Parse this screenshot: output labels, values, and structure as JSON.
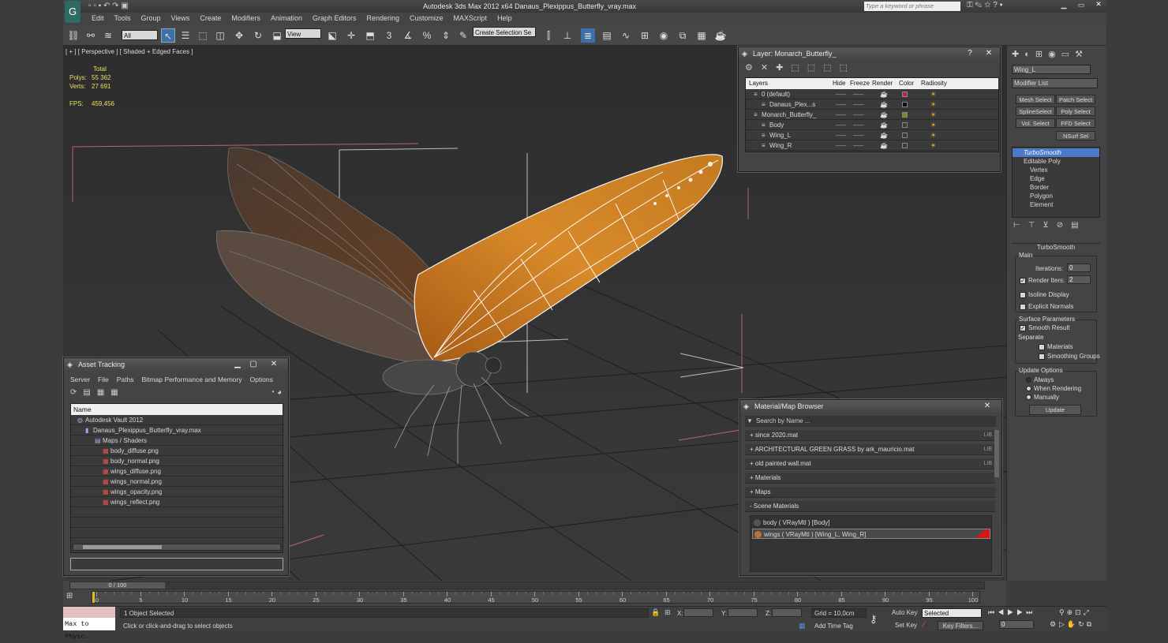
{
  "window": {
    "title": "Autodesk 3ds Max  2012 x64     Danaus_Plexippus_Butterfly_vray.max",
    "search_placeholder": "Type a keyword or phrase"
  },
  "menu": [
    "Edit",
    "Tools",
    "Group",
    "Views",
    "Create",
    "Modifiers",
    "Animation",
    "Graph Editors",
    "Rendering",
    "Customize",
    "MAXScript",
    "Help"
  ],
  "toolbar": {
    "filter": "All",
    "refcoord": "View",
    "selection_set": "Create Selection Se"
  },
  "viewport": {
    "label": "[ + ] [ Perspective ] [ Shaded + Edged Faces ]",
    "stats": {
      "header": "Total",
      "polys_label": "Polys:",
      "polys": "55 362",
      "verts_label": "Verts:",
      "verts": "27 691",
      "fps_label": "FPS:",
      "fps": "459,456"
    }
  },
  "layer_panel": {
    "title": "Layer: Monarch_Butterfly_",
    "columns": [
      "Layers",
      "Hide",
      "Freeze",
      "Render",
      "Color",
      "Radiosity"
    ],
    "rows": [
      {
        "name": "0 (default)",
        "color": "#c0205a"
      },
      {
        "name": "Danaus_Plex...s",
        "color": "#111111"
      },
      {
        "name": "Monarch_Butterfly_",
        "color": "#7a8a20"
      },
      {
        "name": "Body",
        "color": "#3a3a3a"
      },
      {
        "name": "Wing_L",
        "color": "#3a3a3a"
      },
      {
        "name": "Wing_R",
        "color": "#3a3a3a"
      }
    ]
  },
  "asset_panel": {
    "title": "Asset Tracking",
    "menu": [
      "Server",
      "File",
      "Paths",
      "Bitmap Performance and Memory",
      "Options"
    ],
    "column": "Name",
    "items": [
      "Autodesk Vault 2012",
      "Danaus_Plexippus_Butterfly_vray.max",
      "Maps / Shaders",
      "body_diffuse.png",
      "body_normal.png",
      "wings_diffuse.png",
      "wings_normal.png",
      "wings_opacity.png",
      "wings_reflect.png"
    ]
  },
  "material_panel": {
    "title": "Material/Map Browser",
    "search": "Search by Name ...",
    "libs": [
      {
        "name": "+ since 2020.mat",
        "tag": "LIB"
      },
      {
        "name": "+ ARCHITECTURAL GREEN GRASS by ark_mauricio.mat",
        "tag": "LIB"
      },
      {
        "name": "+ old painted wall.mat",
        "tag": "LIB"
      },
      {
        "name": "+ Materials",
        "tag": ""
      },
      {
        "name": "+ Maps",
        "tag": ""
      },
      {
        "name": "- Scene Materials",
        "tag": ""
      }
    ],
    "scene": [
      "body  ( VRayMtl )  [Body]",
      "wings  ( VRayMtl )  [Wing_L, Wing_R]"
    ]
  },
  "command_panel": {
    "object_name": "Wing_L",
    "modifier_list": "Modifier List",
    "buttons": [
      "Mesh Select",
      "Patch Select",
      "SplineSelect",
      "Poly Select",
      "Vol. Select",
      "FFD Select",
      "NSurf Sel"
    ],
    "stack": [
      "TurboSmooth",
      "Editable Poly",
      "Vertex",
      "Edge",
      "Border",
      "Polygon",
      "Element"
    ],
    "rollout": "TurboSmooth",
    "main": "Main",
    "iterations_label": "Iterations:",
    "iterations": "0",
    "render_iters_label": "Render Iters:",
    "render_iters": "2",
    "isoline": "Isoline Display",
    "explicit": "Explicit Normals",
    "surface": "Surface Parameters",
    "smooth_result": "Smooth Result",
    "separate": "Separate",
    "materials": "Materials",
    "smoothing": "Smoothing Groups",
    "update_options": "Update Options",
    "always": "Always",
    "when_rendering": "When Rendering",
    "manually": "Manually",
    "update": "Update"
  },
  "timeline": {
    "frame": "0 / 100",
    "ticks": [
      "0",
      "5",
      "10",
      "15",
      "20",
      "25",
      "30",
      "35",
      "40",
      "45",
      "50",
      "55",
      "60",
      "65",
      "70",
      "75",
      "80",
      "85",
      "90",
      "95",
      "100"
    ]
  },
  "status": {
    "maxscript": "Max to Physc.",
    "selected": "1 Object Selected",
    "prompt": "Click or click-and-drag to select objects",
    "x": "X:",
    "y": "Y:",
    "z": "Z:",
    "grid": "Grid = 10,0cm",
    "add_time_tag": "Add Time Tag",
    "auto_key": "Auto Key",
    "set_key": "Set Key",
    "key_mode": "Selected",
    "key_filters": "Key Filters...",
    "frame": "0"
  }
}
